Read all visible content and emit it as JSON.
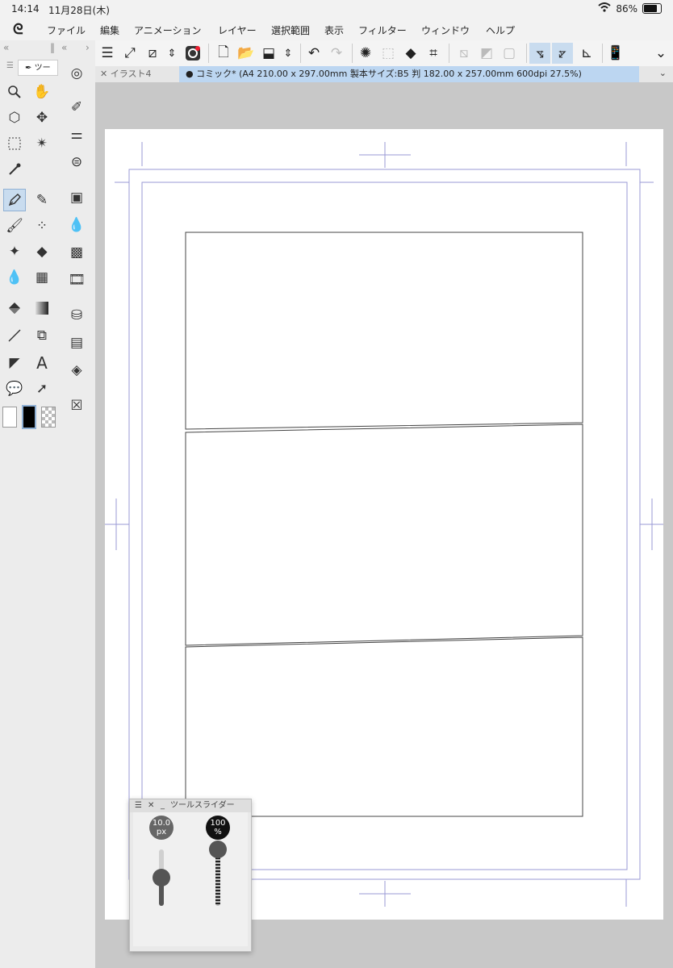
{
  "status": {
    "time": "14:14",
    "date": "11月28日(木)",
    "battery": "86%"
  },
  "menu": [
    "ファイル",
    "編集",
    "アニメーション",
    "レイヤー",
    "選択範囲",
    "表示",
    "フィルター",
    "ウィンドウ",
    "ヘルプ"
  ],
  "tool_panel": {
    "tab_label": "ツー"
  },
  "doc_tabs": [
    {
      "label": "イラスト4",
      "active": false
    },
    {
      "label": "コミック* (A4 210.00 x 297.00mm 製本サイズ:B5 判 182.00 x 257.00mm 600dpi 27.5%)",
      "active": true
    }
  ],
  "tool_slider": {
    "title": "ツールスライダー",
    "size_value": "10.0",
    "size_unit": "px",
    "opacity_value": "100",
    "opacity_unit": "%",
    "size_level": 0.5,
    "opacity_level": 1.0
  },
  "colors": {
    "accent": "#c9dcef",
    "guide": "#9a9ad6",
    "panel": "#ececec"
  }
}
